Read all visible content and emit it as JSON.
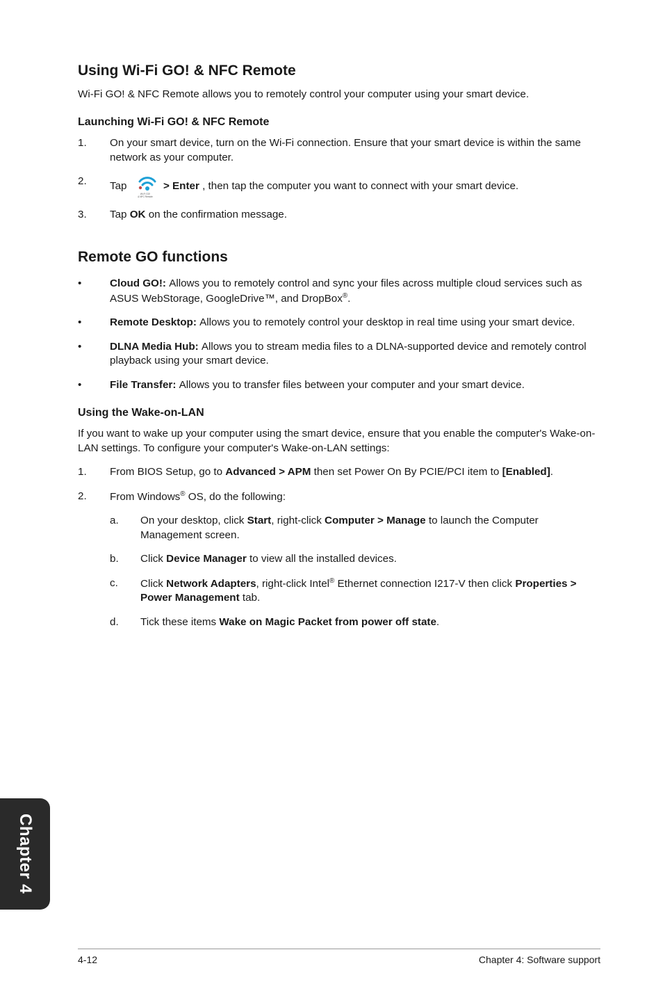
{
  "headings": {
    "main": "Using Wi-Fi GO! & NFC Remote",
    "launching": "Launching Wi-Fi GO! & NFC Remote",
    "functions": "Remote GO functions",
    "wol": "Using the Wake-on-LAN"
  },
  "intro": "Wi-Fi GO! & NFC Remote allows you to remotely control your computer using your smart device.",
  "launch_steps": [
    {
      "num": "1.",
      "text": "On your smart device, turn on the Wi-Fi connection. Ensure that your smart device is within the same network as your computer."
    },
    {
      "num": "2.",
      "prefix": "Tap ",
      "bold_after_icon": " > Enter",
      "suffix": ", then tap the computer you want to connect with your smart device."
    },
    {
      "num": "3.",
      "prefix": "Tap ",
      "bold": "OK",
      "suffix": " on the confirmation message."
    }
  ],
  "functions_list": [
    {
      "title": "Cloud GO!:  ",
      "body_before_reg": "Allows you to remotely control and sync your files across multiple cloud services such as ASUS WebStorage, GoogleDrive™, and DropBox",
      "body_after_reg": "."
    },
    {
      "title": "Remote Desktop:  ",
      "body": "Allows you to remotely control your desktop in real time using your smart device."
    },
    {
      "title": "DLNA Media Hub:  ",
      "body": "Allows you to stream media files to a DLNA-supported device and remotely control playback using your smart device."
    },
    {
      "title": "File Transfer:  ",
      "body": "Allows you to transfer files between your computer and your smart device."
    }
  ],
  "wol_intro": "If you want to wake up your computer using the smart device, ensure that you enable the computer's Wake-on-LAN settings. To configure your computer's Wake-on-LAN settings:",
  "wol_steps": [
    {
      "num": "1.",
      "segments": [
        {
          "t": "From BIOS Setup, go to "
        },
        {
          "b": "Advanced > APM"
        },
        {
          "t": " then set Power On By PCIE/PCI item to "
        },
        {
          "b": "[Enabled]"
        },
        {
          "t": "."
        }
      ]
    },
    {
      "num": "2.",
      "segments": [
        {
          "t": "From Windows"
        },
        {
          "reg": "®"
        },
        {
          "t": " OS, do the following:"
        }
      ],
      "sub": [
        {
          "letter": "a.",
          "segments": [
            {
              "t": "On your desktop, click "
            },
            {
              "b": "Start"
            },
            {
              "t": ", right-click "
            },
            {
              "b": "Computer > Manage"
            },
            {
              "t": " to launch the Computer Management screen."
            }
          ]
        },
        {
          "letter": "b.",
          "segments": [
            {
              "t": "Click "
            },
            {
              "b": "Device Manager"
            },
            {
              "t": " to view all the installed devices."
            }
          ]
        },
        {
          "letter": "c.",
          "segments": [
            {
              "t": "Click "
            },
            {
              "b": "Network Adapters"
            },
            {
              "t": ", right-click Intel"
            },
            {
              "reg": "®"
            },
            {
              "t": " Ethernet connection I217-V then click "
            },
            {
              "b": "Properties > Power Management"
            },
            {
              "t": " tab."
            }
          ]
        },
        {
          "letter": "d.",
          "segments": [
            {
              "t": "Tick these items "
            },
            {
              "b": "Wake on Magic Packet from power off state"
            },
            {
              "t": "."
            }
          ]
        }
      ]
    }
  ],
  "sidetab": "Chapter 4",
  "footer": {
    "left": "4-12",
    "right": "Chapter 4: Software support"
  },
  "icon_caption": {
    "line1": "Wi-Fi GO!",
    "line2": "& NFC Remote"
  }
}
